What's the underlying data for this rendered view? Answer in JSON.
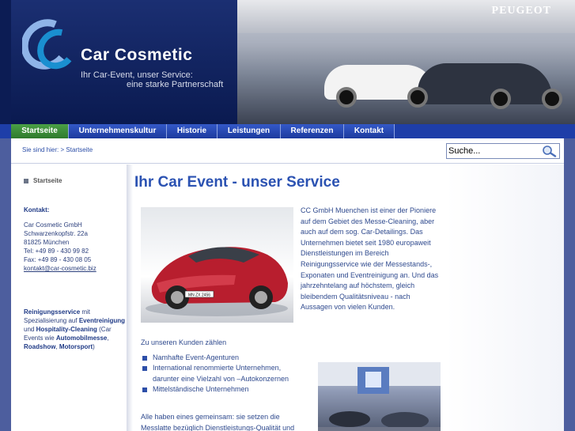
{
  "header": {
    "logo_title": "Car Cosmetic",
    "tagline_1": "Ihr Car-Event, unser Service:",
    "tagline_2": "eine starke Partnerschaft",
    "photo_brand": "PEUGEOT"
  },
  "nav": {
    "items": [
      {
        "label": "Startseite",
        "active": true
      },
      {
        "label": "Unternehmenskultur",
        "active": false
      },
      {
        "label": "Historie",
        "active": false
      },
      {
        "label": "Leistungen",
        "active": false
      },
      {
        "label": "Referenzen",
        "active": false
      },
      {
        "label": "Kontakt",
        "active": false
      }
    ]
  },
  "breadcrumb": {
    "prefix": "Sie sind hier:",
    "separator": ">",
    "current": "Startseite"
  },
  "search": {
    "placeholder": "Suche..."
  },
  "sidebar": {
    "item": "Startseite",
    "contact_heading": "Kontakt:",
    "contact_lines": [
      "Car Cosmetic GmbH",
      "Schwarzenkopfstr. 22a",
      "81825 München",
      "Tel: +49 89 - 430 99 82",
      "Fax: +49 89 - 430 08 05"
    ],
    "email": "kontakt@car-cosmetic.biz",
    "desc": {
      "b1": "Reinigungsservice",
      "t1": " mit Spezialisierung auf ",
      "b2": "Eventreinigung",
      "t2": " und ",
      "b3": "Hospitality-Cleaning",
      "t3": " (Car Events wie ",
      "b4": "Automobilmesse",
      "t4": ", ",
      "b5": "Roadshow",
      "t5": ", ",
      "b6": "Motorsport",
      "t6": ")"
    }
  },
  "main": {
    "title": "Ihr Car Event - unser Service",
    "car_plate": "MN ZX 2456",
    "intro": "CC GmbH Muenchen ist einer der Pioniere auf dem Gebiet des Messe-Cleaning, aber auch auf dem sog. Car-Detailings. Das Unternehmen bietet seit 1980 europaweit Dienstleistungen im Bereich Reinigungsservice wie der Messestands-, Exponaten und Eventreinigung an. Und das jahrzehntelang auf höchstem, gleich bleibendem Qualitätsniveau - nach Aussagen von vielen Kunden.",
    "kunden_heading": "Zu unseren Kunden zählen",
    "kunden": [
      "Namhafte Event-Agenturen",
      "International renommierte Unternehmen, darunter eine Vielzahl von –Autokonzernen",
      "Mittelständische Unternehmen"
    ],
    "outro": "Alle haben eines gemeinsam: sie setzen die Messlatte bezüglich Dienstleistungs-Qualität und"
  },
  "colors": {
    "nav_blue": "#1e3ea8",
    "nav_active": "#2f7a2c",
    "title_blue": "#2b52b2",
    "header_navy": "#0c1c54"
  }
}
